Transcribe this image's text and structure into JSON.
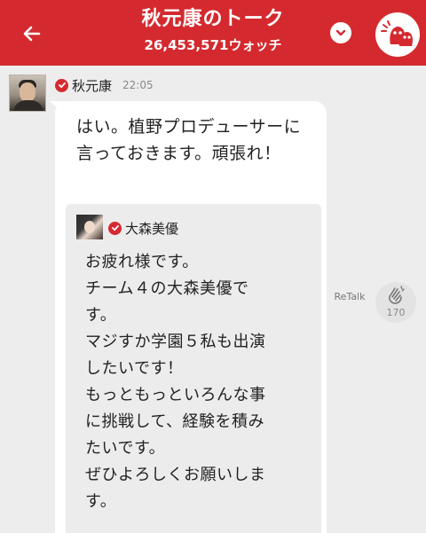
{
  "header": {
    "title": "秋元康のトーク",
    "watch_count": "26,453,571ウォッチ"
  },
  "post": {
    "sender": "秋元康",
    "time": "22:05",
    "text": "はい。植野プロデューサーに言っておきます。頑張れ！"
  },
  "quote": {
    "sender": "大森美優",
    "lines": [
      "お疲れ様です。",
      "チーム４の大森美優で",
      "す。",
      "マジすか学園５私も出演",
      "したいです！",
      "もっともっといろんな事",
      "に挑戦して、経験を積み",
      "たいです。",
      "ぜひよろしくお願いしま",
      "す。"
    ]
  },
  "actions": {
    "retalk_label": "ReTalk",
    "clap_count": "170"
  },
  "colors": {
    "brand_red": "#d42a2f",
    "background": "#ededed",
    "bubble": "#ffffff",
    "quote_bg": "#ececec"
  },
  "icons": {
    "back": "arrow-left-icon",
    "dropdown": "chevron-down-icon",
    "watch": "ghost-mascot-icon",
    "verified": "check-circle-icon",
    "clap": "clap-hands-icon"
  }
}
